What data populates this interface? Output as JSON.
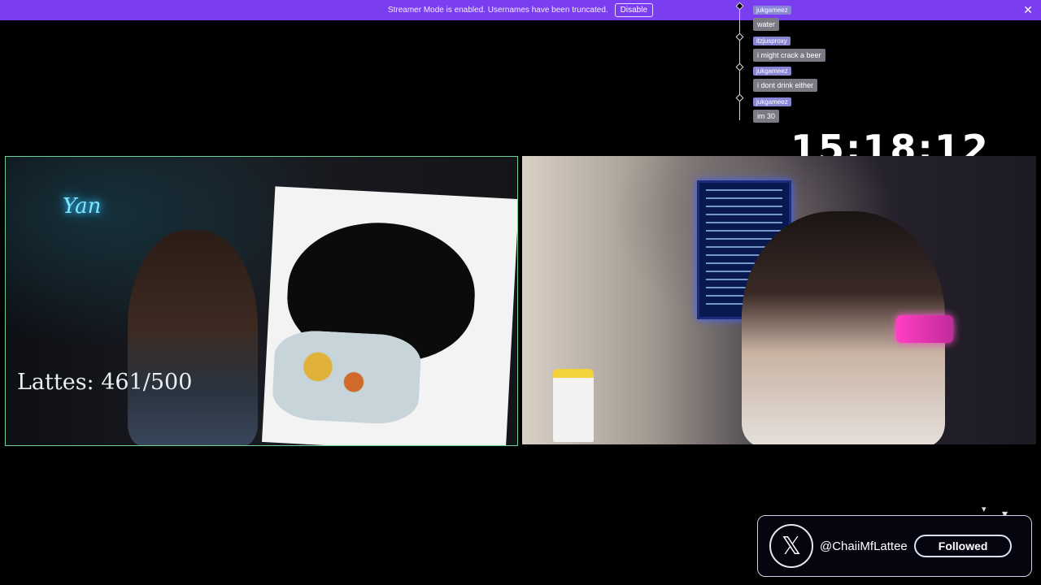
{
  "banner": {
    "message": "Streamer Mode is enabled. Usernames have been truncated.",
    "disable_label": "Disable",
    "close_icon": "close-icon",
    "color": "#7a3df0"
  },
  "chat": {
    "messages": [
      {
        "user": "jukgameez",
        "text": "water"
      },
      {
        "user": "itzjusproxy",
        "text": "i might crack a beer"
      },
      {
        "user": "jukgameez",
        "text": "i dont drink either"
      },
      {
        "user": "jukgameez",
        "text": "im 30"
      }
    ]
  },
  "timer": "15:18:12",
  "left_cam": {
    "neon_sign": "Yan",
    "goal_text": "Lattes: 461/500",
    "border_color": "#6fcf9a"
  },
  "follow_card": {
    "logo_icon": "x-logo-icon",
    "handle": "@ChaiiMfLattee",
    "button_label": "Followed"
  }
}
